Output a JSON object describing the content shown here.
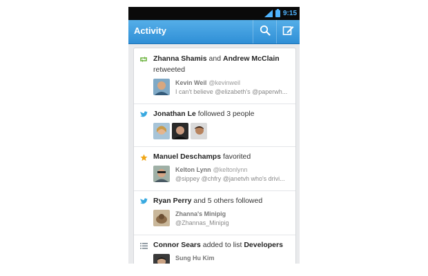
{
  "status_bar": {
    "time": "9:15",
    "signal_icon": "signal-icon",
    "battery_icon": "battery-icon"
  },
  "action_bar": {
    "title": "Activity",
    "search_icon": "search-icon",
    "compose_icon": "compose-icon"
  },
  "colors": {
    "action_bar": "#3a99de",
    "status_time": "#4fb4ff",
    "retweet": "#6cb33e",
    "twitter_bird": "#39a9e0",
    "favorite_star": "#f0a616"
  },
  "activity": [
    {
      "icon": "retweet-icon",
      "actor": "Zhanna Shamis",
      "joiner": "and",
      "actor2": "Andrew McClain",
      "action": "retweeted",
      "tweet": {
        "name": "Kevin Weil",
        "handle": "@kevinweil",
        "text": "I can't believe @elizabeth's @paperwh..."
      }
    },
    {
      "icon": "twitter-bird-icon",
      "actor": "Jonathan Le",
      "action": "followed 3 people"
    },
    {
      "icon": "star-icon",
      "actor": "Manuel Deschamps",
      "action": "favorited",
      "tweet": {
        "name": "Kelton Lynn",
        "handle": "@keltonlynn",
        "text": "@sippey @chfry @janetvh who's drivi..."
      }
    },
    {
      "icon": "twitter-bird-icon",
      "actor": "Ryan Perry",
      "action": "and 5 others followed",
      "tweet": {
        "name": "Zhanna's Minipig",
        "handle": "",
        "text": "@Zhannas_Minipig"
      }
    },
    {
      "icon": "list-icon",
      "actor": "Connor Sears",
      "action": "added to list",
      "target": "Developers",
      "tweet": {
        "name": "Sung Hu Kim",
        "handle": "",
        "text": ""
      }
    }
  ]
}
